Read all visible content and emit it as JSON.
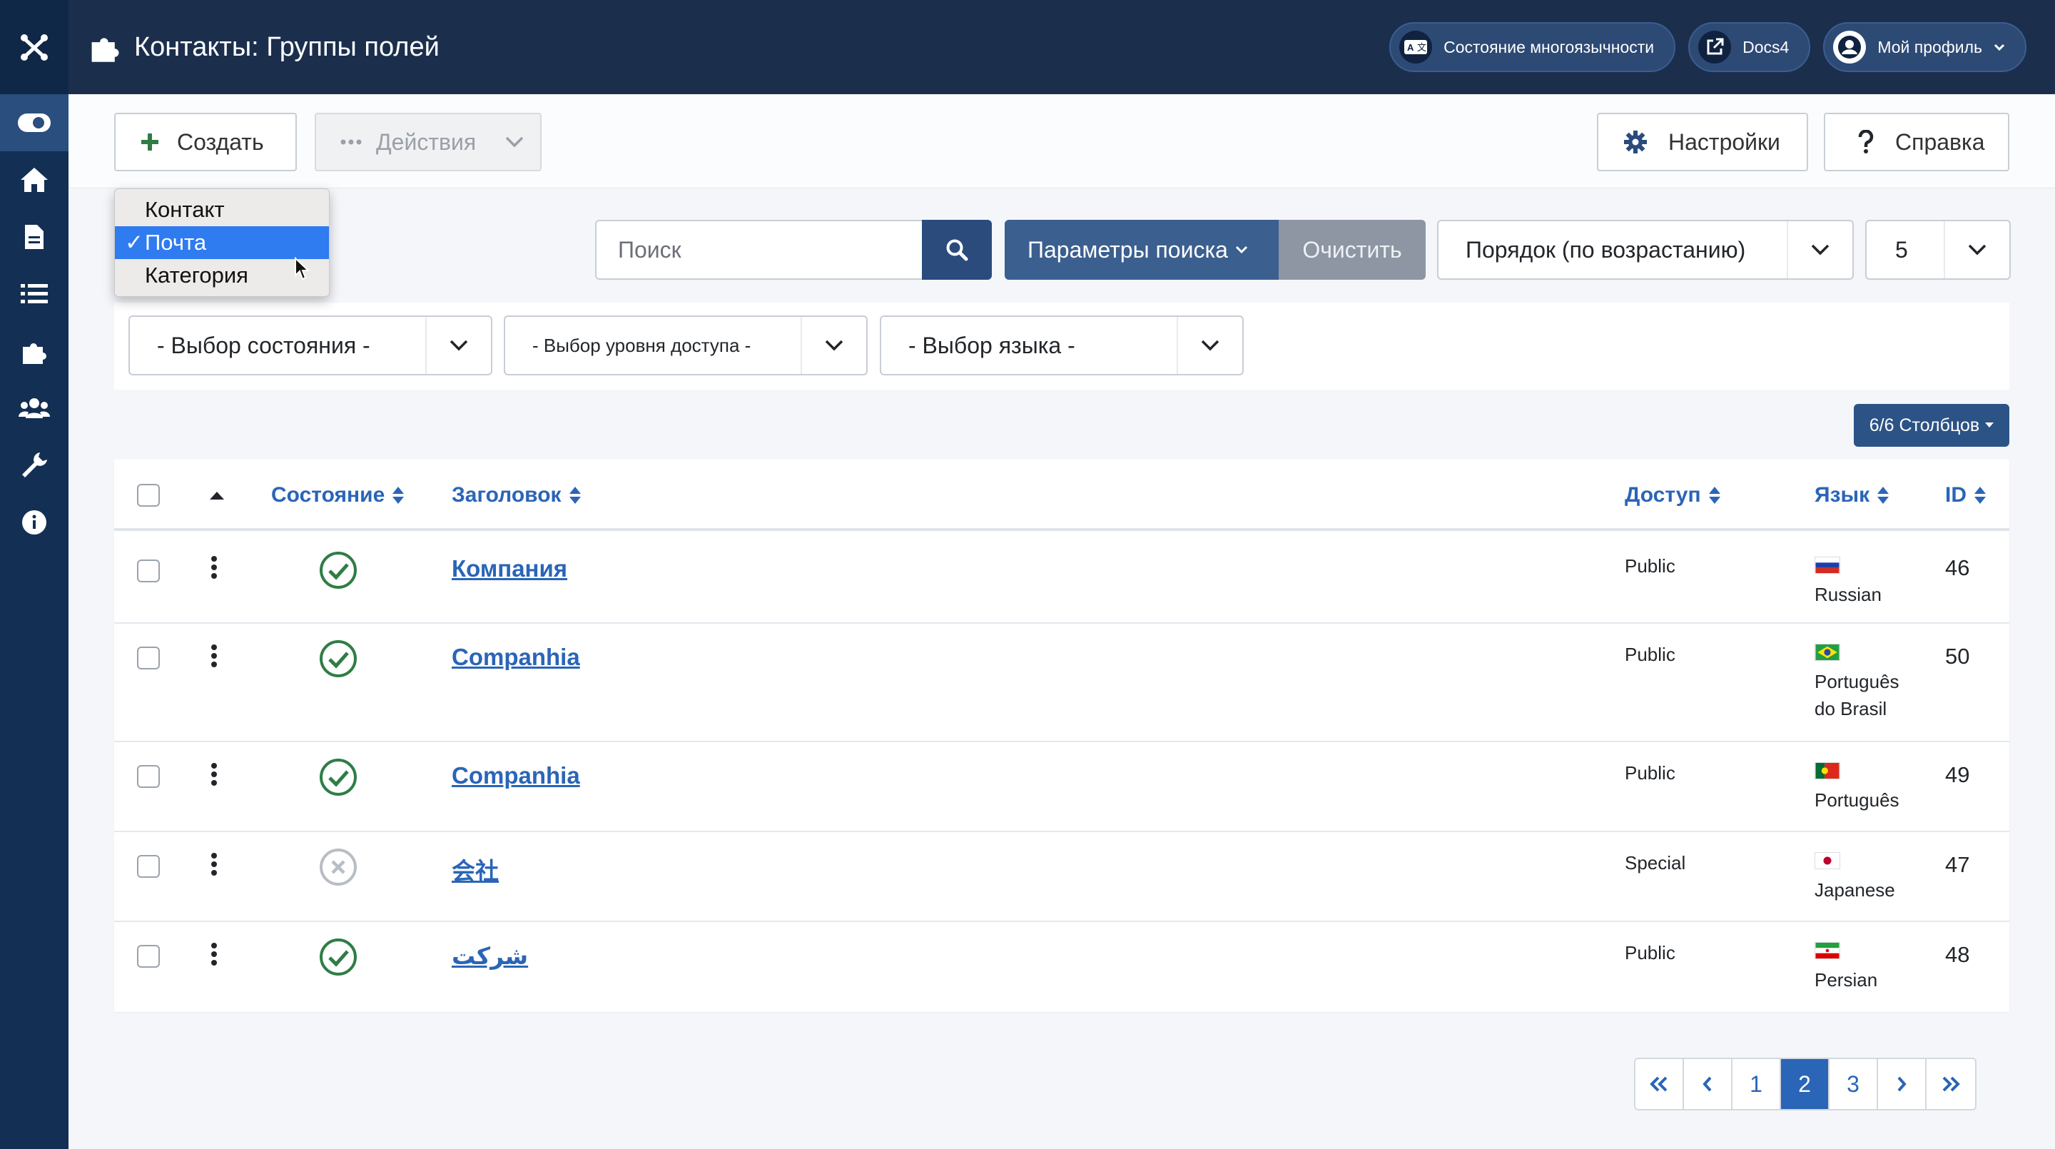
{
  "header": {
    "title": "Контакты: Группы полей",
    "multilang_label": "Состояние многоязычности",
    "docs_label": "Docs4",
    "profile_label": "Мой профиль"
  },
  "toolbar": {
    "create_label": "Создать",
    "actions_label": "Действия",
    "settings_label": "Настройки",
    "help_label": "Справка"
  },
  "context_menu": {
    "items": [
      "Контакт",
      "Почта",
      "Категория"
    ],
    "selected": "Почта",
    "check_mark": "✓"
  },
  "search": {
    "placeholder": "Поиск",
    "options_label": "Параметры поиска",
    "clear_label": "Очистить",
    "ordering": "Порядок (по возрастанию)",
    "limit": "5"
  },
  "filters": {
    "state": "- Выбор состояния -",
    "access": "- Выбор уровня доступа -",
    "language": "- Выбор языка -"
  },
  "columns_button": "6/6 Столбцов",
  "table": {
    "headers": {
      "state": "Состояние",
      "title": "Заголовок",
      "access": "Доступ",
      "language": "Язык",
      "id": "ID"
    },
    "rows": [
      {
        "title": "Компания",
        "published": true,
        "access": "Public",
        "language": "Russian",
        "flag": "ru",
        "id": "46"
      },
      {
        "title": "Companhia",
        "published": true,
        "access": "Public",
        "language_line1": "Português",
        "language_line2": "do Brasil",
        "flag": "br",
        "id": "50"
      },
      {
        "title": "Companhia",
        "published": true,
        "access": "Public",
        "language": "Português",
        "flag": "pt",
        "id": "49"
      },
      {
        "title": "会社",
        "published": false,
        "access": "Special",
        "language": "Japanese",
        "flag": "jp",
        "id": "47"
      },
      {
        "title": "شرکت",
        "published": true,
        "access": "Public",
        "language": "Persian",
        "flag": "ir",
        "id": "48"
      }
    ]
  },
  "pagination": {
    "first": "«",
    "prev": "‹",
    "pages": [
      "1",
      "2",
      "3"
    ],
    "active": "2",
    "next": "›",
    "last": "»"
  },
  "colors": {
    "sidebar": "#132f53",
    "header": "#1b2f4d",
    "accent": "#2a65b7",
    "published": "#2f7d45",
    "unpublished": "#b9bec5"
  },
  "icons": {
    "sidebar": [
      "joomla-logo-icon",
      "toggle-menu-icon",
      "home-icon",
      "document-icon",
      "list-icon",
      "puzzle-icon",
      "users-icon",
      "wrench-icon",
      "info-icon"
    ]
  }
}
